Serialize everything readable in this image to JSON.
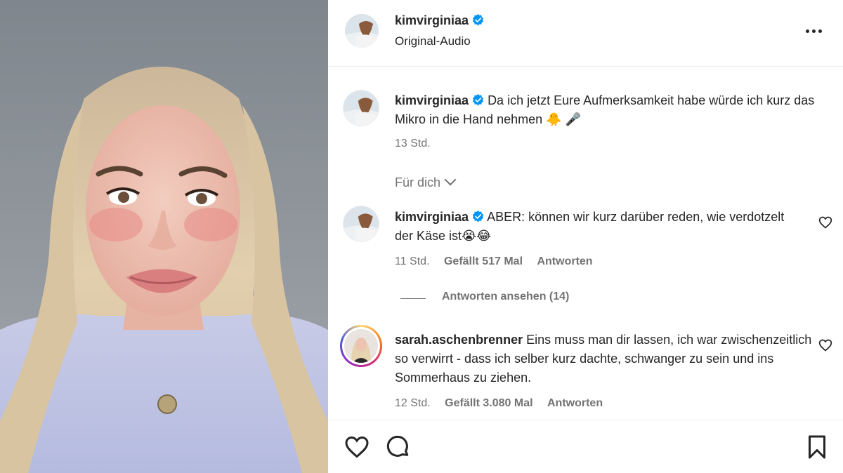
{
  "post": {
    "author": "kimvirginiaa",
    "audio": "Original-Audio"
  },
  "caption": {
    "username": "kimvirginiaa",
    "text": "Da ich jetzt Eure Aufmerksamkeit habe würde ich kurz das Mikro in die Hand nehmen 🐥 🎤",
    "time": "13 Std."
  },
  "filter": {
    "label": "Für dich"
  },
  "comments": [
    {
      "username": "kimvirginiaa",
      "text": "ABER: können wir kurz darüber reden, wie verdotzelt der Käse ist😭😂",
      "time": "11 Std.",
      "likes": "Gefällt 517 Mal",
      "reply": "Antworten",
      "view_replies": "Antworten ansehen (14)"
    },
    {
      "username": "sarah.aschenbrenner",
      "text": "Eins muss man dir lassen, ich war zwischenzeitlich so verwirrt - dass ich selber kurz dachte, schwanger zu sein und ins Sommerhaus zu ziehen.",
      "time": "12 Std.",
      "likes": "Gefällt 3.080 Mal",
      "reply": "Antworten"
    }
  ],
  "icons": {
    "verified": "verified-badge-icon",
    "more": "more-options-icon",
    "like": "heart-icon",
    "comment": "comment-bubble-icon",
    "save": "bookmark-icon"
  },
  "colors": {
    "verified": "#0095f6",
    "text": "#262626",
    "secondary": "#737373"
  }
}
